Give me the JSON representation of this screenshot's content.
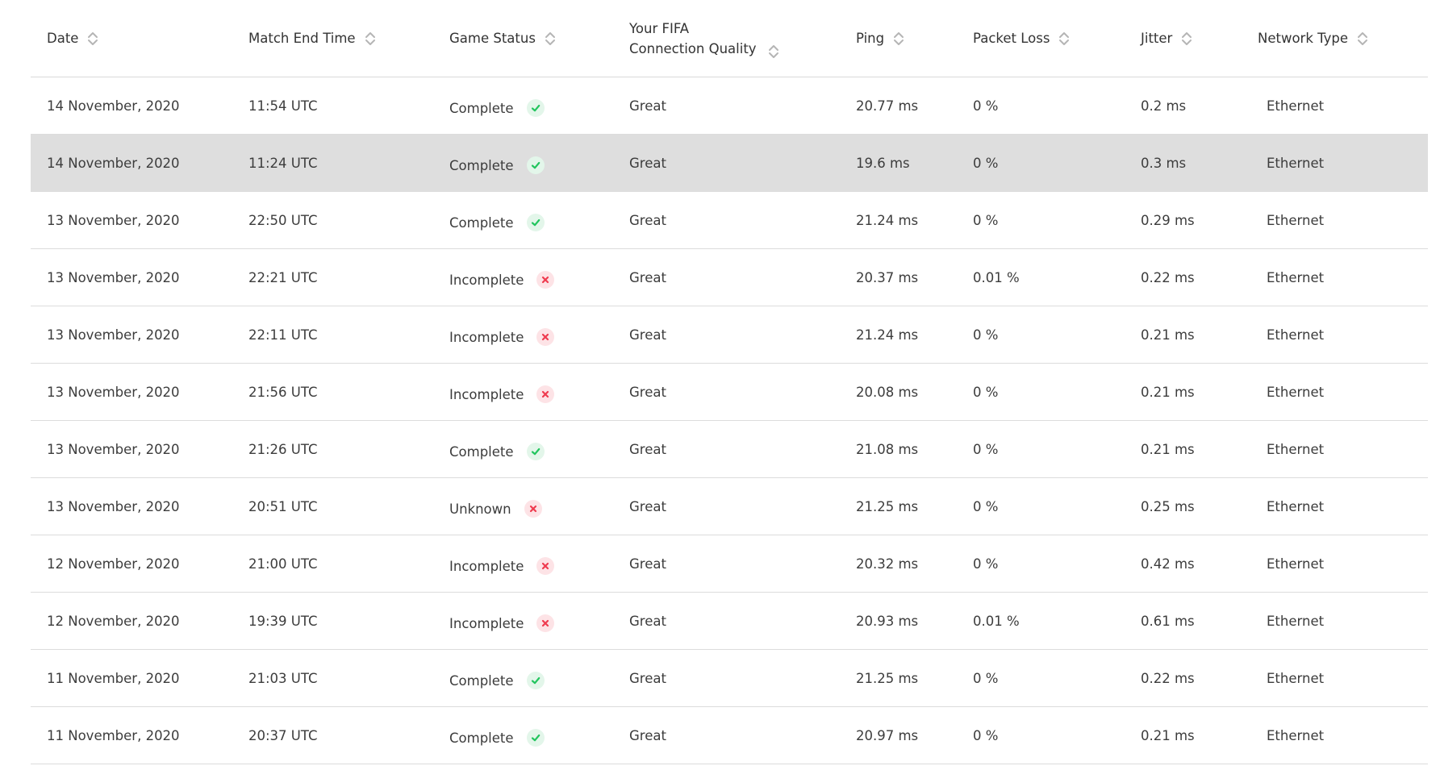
{
  "table": {
    "headers": {
      "date": "Date",
      "match_end_time": "Match End Time",
      "game_status": "Game Status",
      "quality_line1": "Your FIFA",
      "quality_line2": "Connection Quality",
      "ping": "Ping",
      "packet_loss": "Packet Loss",
      "jitter": "Jitter",
      "network_type": "Network Type"
    },
    "status_colors": {
      "complete_icon": "#22c55e",
      "incomplete_icon": "#ef3b4f"
    },
    "rows": [
      {
        "date": "14 November, 2020",
        "time": "11:54 UTC",
        "status": "Complete",
        "status_icon": "check-icon",
        "quality": "Great",
        "ping": "20.77 ms",
        "loss": "0 %",
        "jitter": "0.2 ms",
        "network": "Ethernet"
      },
      {
        "date": "14 November, 2020",
        "time": "11:24 UTC",
        "status": "Complete",
        "status_icon": "check-icon",
        "quality": "Great",
        "ping": "19.6 ms",
        "loss": "0 %",
        "jitter": "0.3 ms",
        "network": "Ethernet"
      },
      {
        "date": "13 November, 2020",
        "time": "22:50 UTC",
        "status": "Complete",
        "status_icon": "check-icon",
        "quality": "Great",
        "ping": "21.24 ms",
        "loss": "0 %",
        "jitter": "0.29 ms",
        "network": "Ethernet"
      },
      {
        "date": "13 November, 2020",
        "time": "22:21 UTC",
        "status": "Incomplete",
        "status_icon": "cross-icon",
        "quality": "Great",
        "ping": "20.37 ms",
        "loss": "0.01 %",
        "jitter": "0.22 ms",
        "network": "Ethernet"
      },
      {
        "date": "13 November, 2020",
        "time": "22:11 UTC",
        "status": "Incomplete",
        "status_icon": "cross-icon",
        "quality": "Great",
        "ping": "21.24 ms",
        "loss": "0 %",
        "jitter": "0.21 ms",
        "network": "Ethernet"
      },
      {
        "date": "13 November, 2020",
        "time": "21:56 UTC",
        "status": "Incomplete",
        "status_icon": "cross-icon",
        "quality": "Great",
        "ping": "20.08 ms",
        "loss": "0 %",
        "jitter": "0.21 ms",
        "network": "Ethernet"
      },
      {
        "date": "13 November, 2020",
        "time": "21:26 UTC",
        "status": "Complete",
        "status_icon": "check-icon",
        "quality": "Great",
        "ping": "21.08 ms",
        "loss": "0 %",
        "jitter": "0.21 ms",
        "network": "Ethernet"
      },
      {
        "date": "13 November, 2020",
        "time": "20:51 UTC",
        "status": "Unknown",
        "status_icon": "cross-icon",
        "quality": "Great",
        "ping": "21.25 ms",
        "loss": "0 %",
        "jitter": "0.25 ms",
        "network": "Ethernet"
      },
      {
        "date": "12 November, 2020",
        "time": "21:00 UTC",
        "status": "Incomplete",
        "status_icon": "cross-icon",
        "quality": "Great",
        "ping": "20.32 ms",
        "loss": "0 %",
        "jitter": "0.42 ms",
        "network": "Ethernet"
      },
      {
        "date": "12 November, 2020",
        "time": "19:39 UTC",
        "status": "Incomplete",
        "status_icon": "cross-icon",
        "quality": "Great",
        "ping": "20.93 ms",
        "loss": "0.01 %",
        "jitter": "0.61 ms",
        "network": "Ethernet"
      },
      {
        "date": "11 November, 2020",
        "time": "21:03 UTC",
        "status": "Complete",
        "status_icon": "check-icon",
        "quality": "Great",
        "ping": "21.25 ms",
        "loss": "0 %",
        "jitter": "0.22 ms",
        "network": "Ethernet"
      },
      {
        "date": "11 November, 2020",
        "time": "20:37 UTC",
        "status": "Complete",
        "status_icon": "check-icon",
        "quality": "Great",
        "ping": "20.97 ms",
        "loss": "0 %",
        "jitter": "0.21 ms",
        "network": "Ethernet"
      }
    ]
  }
}
